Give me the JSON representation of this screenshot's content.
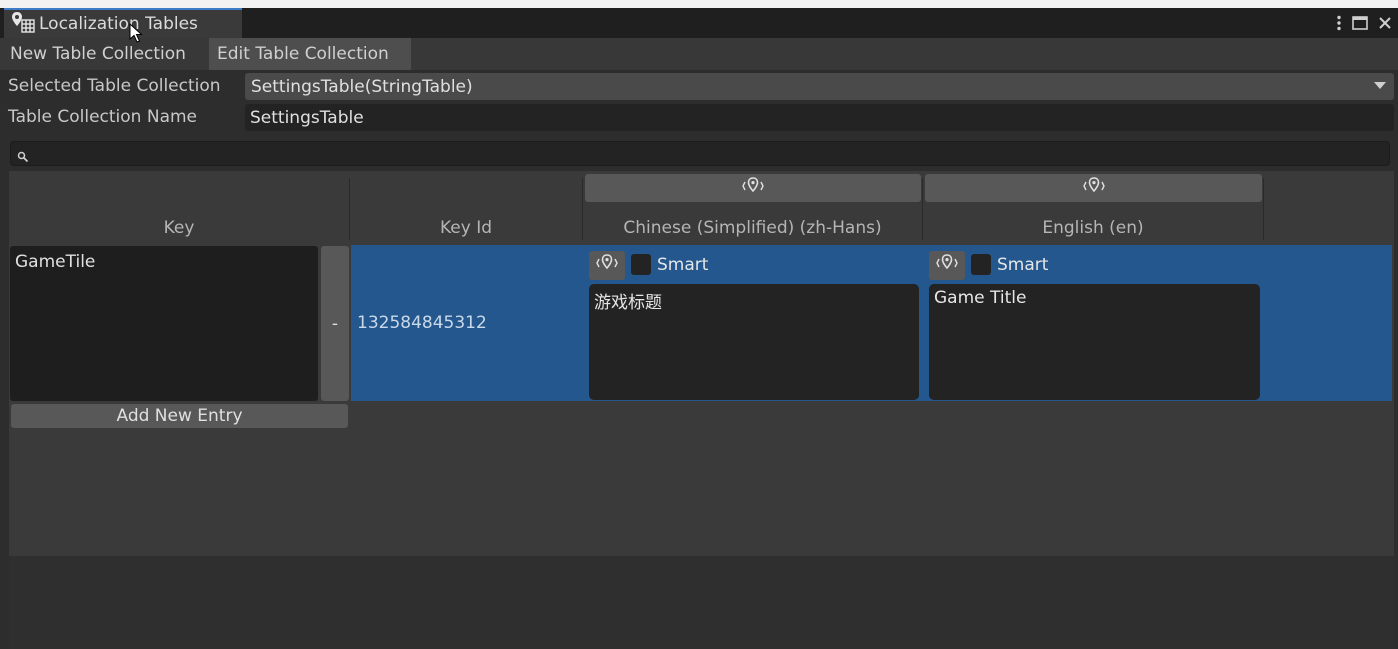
{
  "window": {
    "title": "Localization Tables",
    "title_icon": "localization-tables-icon",
    "controls": [
      "kebab-menu-icon",
      "maximize-icon",
      "close-icon"
    ]
  },
  "mode_tabs": [
    {
      "label": "New Table Collection",
      "active": false
    },
    {
      "label": "Edit Table Collection",
      "active": true
    }
  ],
  "properties": {
    "selected_collection_label": "Selected Table Collection",
    "selected_collection_value": "SettingsTable(StringTable)",
    "name_label": "Table Collection Name",
    "name_value": "SettingsTable"
  },
  "search": {
    "placeholder": "",
    "icon": "search-icon"
  },
  "table": {
    "columns": [
      "Key",
      "Key Id",
      "Chinese (Simplified) (zh-Hans)",
      "English (en)"
    ],
    "rows": [
      {
        "key": "GameTile",
        "remove_label": "-",
        "key_id": "132584845312",
        "chinese": {
          "smart_label": "Smart",
          "value": "游戏标题"
        },
        "english": {
          "smart_label": "Smart",
          "value": "Game Title"
        }
      }
    ],
    "add_entry_label": "Add New Entry"
  },
  "colors": {
    "accent": "#3d7bc7",
    "selected_row": "#24578e",
    "panel": "#2d2d2d",
    "field": "#232323"
  }
}
